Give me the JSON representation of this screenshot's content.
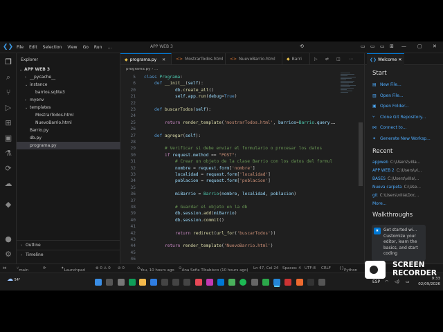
{
  "titlebar": {
    "menu": [
      "File",
      "Edit",
      "Selection",
      "View",
      "Go",
      "Run",
      "…"
    ],
    "window_title": "APP WEB 3"
  },
  "sidebar": {
    "header": "Explorer",
    "items": [
      {
        "label": "APP WEB 3",
        "kind": "root",
        "chevron": "down"
      },
      {
        "label": "__pycache__",
        "kind": "folder",
        "chevron": "right"
      },
      {
        "label": "instance",
        "kind": "folder",
        "chevron": "down"
      },
      {
        "label": "barrios.sqlite3",
        "kind": "file"
      },
      {
        "label": "myenv",
        "kind": "folder",
        "chevron": "right"
      },
      {
        "label": "templates",
        "kind": "folder",
        "chevron": "down"
      },
      {
        "label": "MostrarTodos.html",
        "kind": "file"
      },
      {
        "label": "NuevoBarrio.html",
        "kind": "file"
      },
      {
        "label": "Barrio.py",
        "kind": "file"
      },
      {
        "label": "db.py",
        "kind": "file"
      },
      {
        "label": "programa.py",
        "kind": "file",
        "selected": true
      }
    ],
    "outline_label": "Outline",
    "timeline_label": "Timeline"
  },
  "tabs": [
    {
      "label": "programa.py",
      "active": true,
      "icon": "python-icon"
    },
    {
      "label": "MostrarTodos.html",
      "active": false,
      "icon": "html-icon"
    },
    {
      "label": "NuevoBarrio.html",
      "active": false,
      "icon": "html-icon"
    },
    {
      "label": "Barri",
      "active": false,
      "icon": "python-icon"
    }
  ],
  "breadcrumb": "programa.py › …",
  "editor": {
    "lines": [
      {
        "n": "5",
        "indent": 0,
        "tokens": [
          [
            "kw",
            "class "
          ],
          [
            "cl",
            "Programa"
          ],
          [
            "pl",
            ":"
          ]
        ]
      },
      {
        "n": "6",
        "indent": 1,
        "tokens": [
          [
            "kw",
            "def "
          ],
          [
            "fn",
            "__init__"
          ],
          [
            "pl",
            "("
          ],
          [
            "va",
            "self"
          ],
          [
            "pl",
            "):"
          ]
        ]
      },
      {
        "n": "20",
        "indent": 3,
        "tokens": [
          [
            "va",
            "db"
          ],
          [
            "pl",
            "."
          ],
          [
            "fn",
            "create_all"
          ],
          [
            "pl",
            "()"
          ]
        ]
      },
      {
        "n": "21",
        "indent": 3,
        "tokens": [
          [
            "va",
            "self"
          ],
          [
            "pl",
            "."
          ],
          [
            "va",
            "app"
          ],
          [
            "pl",
            "."
          ],
          [
            "fn",
            "run"
          ],
          [
            "pl",
            "("
          ],
          [
            "va",
            "debug"
          ],
          [
            "pl",
            "="
          ],
          [
            "kw",
            "True"
          ],
          [
            "pl",
            ")"
          ]
        ]
      },
      {
        "n": "22",
        "indent": 0,
        "tokens": []
      },
      {
        "n": "23",
        "indent": 1,
        "tokens": [
          [
            "kw",
            "def "
          ],
          [
            "fn",
            "buscarTodos"
          ],
          [
            "pl",
            "("
          ],
          [
            "va",
            "self"
          ],
          [
            "pl",
            "):"
          ]
        ]
      },
      {
        "n": "24",
        "indent": 0,
        "tokens": []
      },
      {
        "n": "25",
        "indent": 2,
        "tokens": [
          [
            "kc",
            "return "
          ],
          [
            "fn",
            "render_template"
          ],
          [
            "pl",
            "("
          ],
          [
            "st",
            "'mostrarTodos.html'"
          ],
          [
            "pl",
            ", "
          ],
          [
            "va",
            "barrios"
          ],
          [
            "pl",
            "="
          ],
          [
            "cl",
            "Barrio"
          ],
          [
            "pl",
            "."
          ],
          [
            "va",
            "query"
          ],
          [
            "pl",
            ".…"
          ]
        ]
      },
      {
        "n": "26",
        "indent": 0,
        "tokens": []
      },
      {
        "n": "27",
        "indent": 1,
        "tokens": [
          [
            "kw",
            "def "
          ],
          [
            "fn",
            "agregar"
          ],
          [
            "pl",
            "("
          ],
          [
            "va",
            "self"
          ],
          [
            "pl",
            "):"
          ]
        ]
      },
      {
        "n": "28",
        "indent": 0,
        "tokens": []
      },
      {
        "n": "29",
        "indent": 2,
        "tokens": [
          [
            "cm",
            "# Verificar si debe enviar el formulario o procesar los datos"
          ]
        ]
      },
      {
        "n": "30",
        "indent": 2,
        "tokens": [
          [
            "kc",
            "if "
          ],
          [
            "va",
            "request"
          ],
          [
            "pl",
            "."
          ],
          [
            "va",
            "method"
          ],
          [
            "pl",
            " == "
          ],
          [
            "st",
            "\"POST\""
          ],
          [
            "pl",
            ":"
          ]
        ]
      },
      {
        "n": "31",
        "indent": 3,
        "tokens": [
          [
            "cm",
            "# Crear un objeto de la clase Barrio con los datos del formul"
          ]
        ]
      },
      {
        "n": "32",
        "indent": 3,
        "tokens": [
          [
            "va",
            "nombre"
          ],
          [
            "pl",
            " = "
          ],
          [
            "va",
            "request"
          ],
          [
            "pl",
            "."
          ],
          [
            "va",
            "form"
          ],
          [
            "pl",
            "["
          ],
          [
            "st",
            "'nombre'"
          ],
          [
            "pl",
            "]"
          ]
        ]
      },
      {
        "n": "33",
        "indent": 3,
        "tokens": [
          [
            "va",
            "localidad"
          ],
          [
            "pl",
            " = "
          ],
          [
            "va",
            "request"
          ],
          [
            "pl",
            "."
          ],
          [
            "va",
            "form"
          ],
          [
            "pl",
            "["
          ],
          [
            "st",
            "'localidad'"
          ],
          [
            "pl",
            "]"
          ]
        ]
      },
      {
        "n": "34",
        "indent": 3,
        "tokens": [
          [
            "va",
            "poblacion"
          ],
          [
            "pl",
            " = "
          ],
          [
            "va",
            "request"
          ],
          [
            "pl",
            "."
          ],
          [
            "va",
            "form"
          ],
          [
            "pl",
            "["
          ],
          [
            "st",
            "'poblacion'"
          ],
          [
            "pl",
            "]"
          ]
        ]
      },
      {
        "n": "35",
        "indent": 0,
        "tokens": []
      },
      {
        "n": "36",
        "indent": 3,
        "tokens": [
          [
            "va",
            "miBarrio"
          ],
          [
            "pl",
            " = "
          ],
          [
            "cl",
            "Barrio"
          ],
          [
            "pl",
            "("
          ],
          [
            "va",
            "nombre"
          ],
          [
            "pl",
            ", "
          ],
          [
            "va",
            "localidad"
          ],
          [
            "pl",
            ", "
          ],
          [
            "va",
            "poblacion"
          ],
          [
            "pl",
            ")"
          ]
        ]
      },
      {
        "n": "37",
        "indent": 0,
        "tokens": []
      },
      {
        "n": "38",
        "indent": 3,
        "tokens": [
          [
            "cm",
            "# Guardar el objeto en la db"
          ]
        ]
      },
      {
        "n": "39",
        "indent": 3,
        "tokens": [
          [
            "va",
            "db"
          ],
          [
            "pl",
            "."
          ],
          [
            "va",
            "session"
          ],
          [
            "pl",
            "."
          ],
          [
            "fn",
            "add"
          ],
          [
            "pl",
            "("
          ],
          [
            "va",
            "miBarrio"
          ],
          [
            "pl",
            ")"
          ]
        ]
      },
      {
        "n": "40",
        "indent": 3,
        "tokens": [
          [
            "va",
            "db"
          ],
          [
            "pl",
            "."
          ],
          [
            "va",
            "session"
          ],
          [
            "pl",
            "."
          ],
          [
            "fn",
            "commit"
          ],
          [
            "pl",
            "()"
          ]
        ]
      },
      {
        "n": "41",
        "indent": 0,
        "tokens": []
      },
      {
        "n": "42",
        "indent": 3,
        "tokens": [
          [
            "kc",
            "return "
          ],
          [
            "fn",
            "redirect"
          ],
          [
            "pl",
            "("
          ],
          [
            "fn",
            "url_for"
          ],
          [
            "pl",
            "("
          ],
          [
            "st",
            "'buscarTodos'"
          ],
          [
            "pl",
            "))"
          ]
        ]
      },
      {
        "n": "43",
        "indent": 0,
        "tokens": []
      },
      {
        "n": "44",
        "indent": 2,
        "tokens": [
          [
            "kc",
            "return "
          ],
          [
            "fn",
            "render_template"
          ],
          [
            "pl",
            "("
          ],
          [
            "st",
            "'NuevoBarrio.html'"
          ],
          [
            "pl",
            ")"
          ]
        ]
      },
      {
        "n": "45",
        "indent": 0,
        "tokens": []
      },
      {
        "n": "46",
        "indent": 0,
        "tokens": []
      }
    ]
  },
  "welcome": {
    "tab_label": "Welcome",
    "start_heading": "Start",
    "start_links": [
      {
        "label": "New File...",
        "icon": "new-file-icon"
      },
      {
        "label": "Open File...",
        "icon": "open-file-icon"
      },
      {
        "label": "Open Folder...",
        "icon": "open-folder-icon"
      },
      {
        "label": "Clone Git Repository...",
        "icon": "git-icon"
      },
      {
        "label": "Connect to...",
        "icon": "remote-icon"
      },
      {
        "label": "Generate New Worksp...",
        "icon": "sparkle-icon"
      }
    ],
    "recent_heading": "Recent",
    "recent": [
      {
        "name": "appweb",
        "path": "C:\\Users\\villa..."
      },
      {
        "name": "APP WEB 2",
        "path": "C:\\Users\\vi..."
      },
      {
        "name": "BASES",
        "path": "C:\\Users\\villa\\..."
      },
      {
        "name": "Nueva carpeta",
        "path": "C:\\Use..."
      },
      {
        "name": "git",
        "path": "C:\\Users\\villa\\Doc..."
      }
    ],
    "more_label": "More...",
    "walkthroughs_heading": "Walkthroughs",
    "card_title": "Get started wi...",
    "card_body": "Customize your editor, learn the basics, and start coding"
  },
  "statusbar": {
    "branch": "main",
    "sync": "⊗ 0 ⚠ 0",
    "launchpad": "Launchpad",
    "ports": "⊘ 0",
    "blame": "You, 10 hours ago",
    "author": "Ana Sofia Tibabisco (10 hours ago)",
    "cursor": "Ln 47, Col 24",
    "spaces": "Spaces: 4",
    "encoding": "UTF-8",
    "eol": "CRLF",
    "language": "Python"
  },
  "taskbar": {
    "weather_temp": "54°",
    "lang": "ESP",
    "time": "9:33",
    "date": "02/09/2026"
  },
  "recorder": {
    "line1": "SCREEN",
    "line2": "RECORDER"
  }
}
